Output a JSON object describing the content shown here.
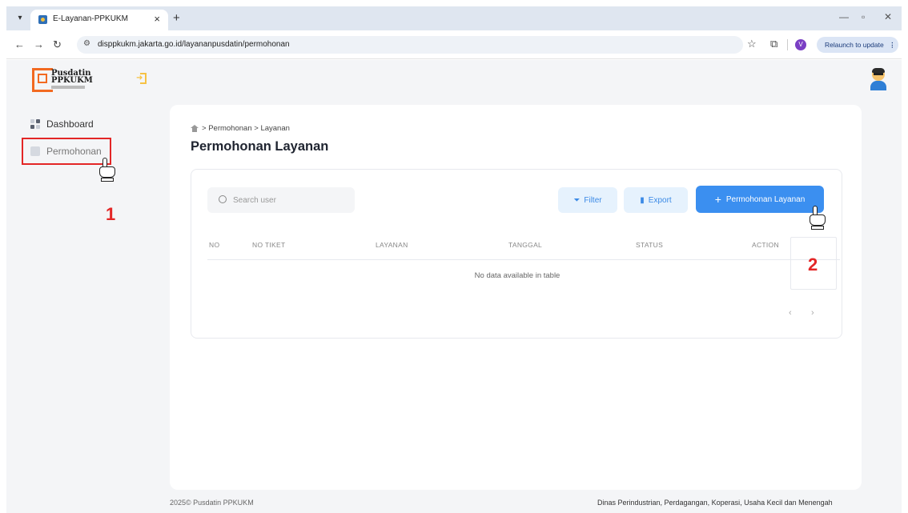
{
  "browser": {
    "tab_title": "E-Layanan-PPKUKM",
    "tab_close": "×",
    "new_tab": "+",
    "url": "disppkukm.jakarta.go.id/layananpusdatin/permohonan",
    "profile_letter": "V",
    "relaunch_label": "Relaunch to update",
    "relaunch_menu": "⋮"
  },
  "sidebar": {
    "logo_line1": "Pusdatin",
    "logo_line2": "PPKUKM",
    "items": [
      {
        "label": "Dashboard"
      },
      {
        "label": "Permohonan"
      }
    ]
  },
  "annotations": {
    "step1": "1",
    "step2": "2"
  },
  "main": {
    "breadcrumb": {
      "sep1": ">",
      "item1": "Permohonan",
      "sep2": ">",
      "item2": "Layanan"
    },
    "title": "Permohonan Layanan",
    "search_placeholder": "Search user",
    "filter_label": "Filter",
    "export_label": "Export",
    "add_label": "Permohonan Layanan",
    "columns": [
      "NO",
      "NO TIKET",
      "LAYANAN",
      "TANGGAL",
      "STATUS",
      "ACTION"
    ],
    "empty_text": "No data available in table",
    "prev": "‹",
    "next": "›"
  },
  "footer": {
    "left": "2025© Pusdatin PPKUKM",
    "right": "Dinas Perindustrian, Perdagangan, Koperasi, Usaha Kecil dan Menengah"
  },
  "colors": {
    "primary": "#3b8ff0",
    "annotation": "#e32626",
    "logo": "#f26a21"
  }
}
